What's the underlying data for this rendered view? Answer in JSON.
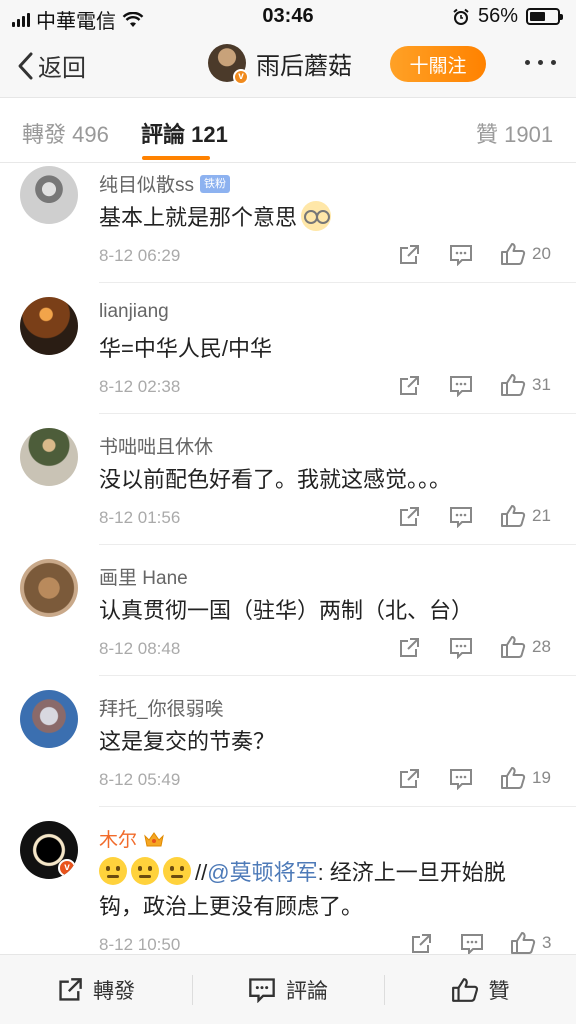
{
  "status_bar": {
    "carrier": "中華電信",
    "time": "03:46",
    "battery": "56%",
    "battery_level": 0.56
  },
  "nav": {
    "back_label": "返回",
    "username": "雨后蘑菇",
    "follow_label": "十關注"
  },
  "tabs": [
    {
      "label": "轉發",
      "count": "496"
    },
    {
      "label": "評論",
      "count": "121"
    },
    {
      "label": "贊",
      "count": "1901"
    }
  ],
  "comments": [
    {
      "user": "纯目似散ss",
      "badge": "铁粉",
      "text": "基本上就是那个意思",
      "time": "8-12 06:29",
      "likes": "20"
    },
    {
      "user": "lianjiang",
      "text": "华=中华人民/中华",
      "time": "8-12 02:38",
      "likes": "31"
    },
    {
      "user": "书咄咄且休休",
      "text": "没以前配色好看了。我就这感觉。。。",
      "time": "8-12 01:56",
      "likes": "21"
    },
    {
      "user": "画里 Hane",
      "text": "认真贯彻一国（驻华）两制（北、台）",
      "time": "8-12 08:48",
      "likes": "28"
    },
    {
      "user": "拜托_你很弱唉",
      "text": "这是复交的节奏？",
      "time": "8-12 05:49",
      "likes": "19"
    },
    {
      "user": "木尔",
      "text_prefix": "//",
      "mention": "@莫顿将军",
      "text": ": 经济上一旦开始脱钩，政治上更没有顾虑了。",
      "time": "8-12 10:50",
      "likes": "3"
    }
  ],
  "bottom_bar": {
    "repost_label": "轉發",
    "comment_label": "評論",
    "like_label": "贊"
  },
  "colors": {
    "accent": "#ff8200",
    "mention": "#4d7ab8",
    "vip_name": "#f16b2b"
  }
}
